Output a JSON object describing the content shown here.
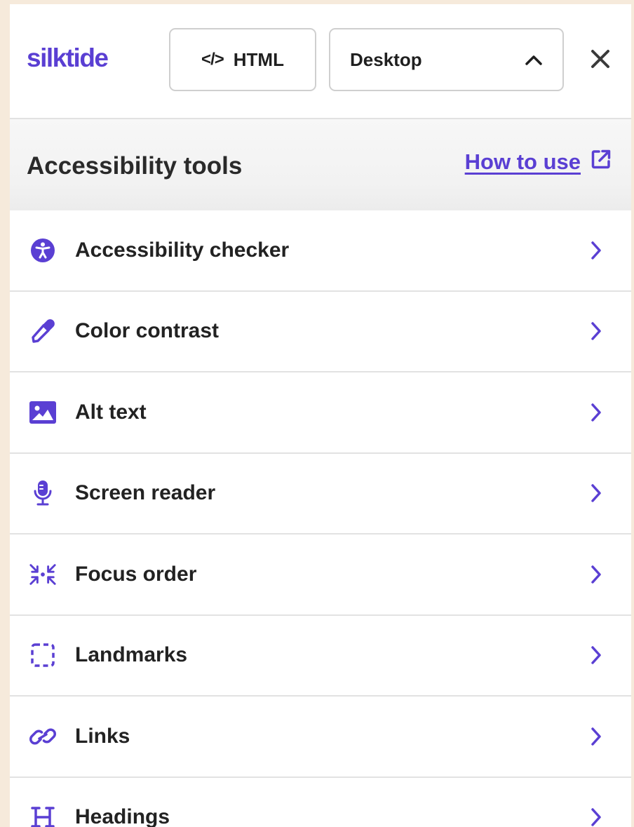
{
  "brand": {
    "logo_text": "silktide",
    "accent": "#5a3fd3"
  },
  "toolbar": {
    "html_label": "HTML",
    "html_icon": "</>",
    "device_selected": "Desktop",
    "device_icon": "chevron-up-icon",
    "close_icon": "close-icon"
  },
  "section": {
    "title": "Accessibility tools",
    "how_to_use": "How to use",
    "how_to_use_icon": "external-link-icon"
  },
  "tools": [
    {
      "label": "Accessibility checker",
      "icon": "accessibility-icon"
    },
    {
      "label": "Color contrast",
      "icon": "eyedropper-icon"
    },
    {
      "label": "Alt text",
      "icon": "image-icon"
    },
    {
      "label": "Screen reader",
      "icon": "microphone-icon"
    },
    {
      "label": "Focus order",
      "icon": "focus-order-icon"
    },
    {
      "label": "Landmarks",
      "icon": "landmarks-icon"
    },
    {
      "label": "Links",
      "icon": "link-icon"
    },
    {
      "label": "Headings",
      "icon": "heading-icon"
    }
  ]
}
